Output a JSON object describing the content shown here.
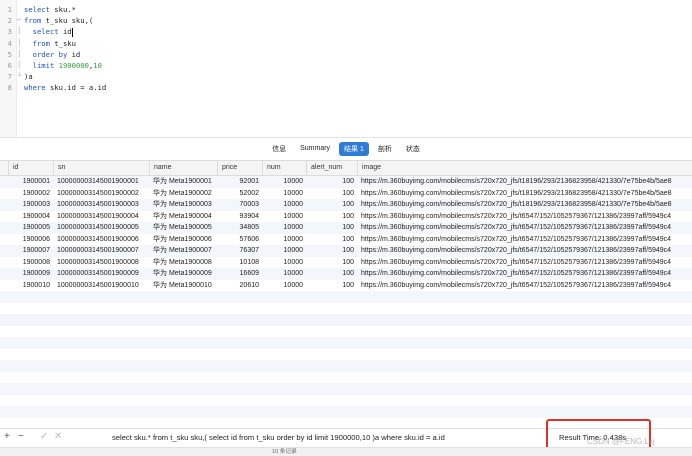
{
  "editor": {
    "lines": [
      {
        "num": "1",
        "fold": "",
        "segments": [
          {
            "t": "select",
            "c": "kw"
          },
          {
            "t": " sku.*",
            "c": "txt"
          }
        ]
      },
      {
        "num": "2",
        "fold": "⌐",
        "segments": [
          {
            "t": "from",
            "c": "kw"
          },
          {
            "t": " t_sku sku,(",
            "c": "txt"
          }
        ]
      },
      {
        "num": "3",
        "fold": "│",
        "segments": [
          {
            "t": "  select",
            "c": "kw"
          },
          {
            "t": " id",
            "c": "txt"
          },
          {
            "t": "|",
            "c": "cur"
          }
        ]
      },
      {
        "num": "4",
        "fold": "│",
        "segments": [
          {
            "t": "  from",
            "c": "kw"
          },
          {
            "t": " t_sku",
            "c": "txt"
          }
        ]
      },
      {
        "num": "5",
        "fold": "│",
        "segments": [
          {
            "t": "  order by",
            "c": "kw"
          },
          {
            "t": " id",
            "c": "txt"
          }
        ]
      },
      {
        "num": "6",
        "fold": "│",
        "segments": [
          {
            "t": "  limit",
            "c": "kw"
          },
          {
            "t": " ",
            "c": "txt"
          },
          {
            "t": "1900000",
            "c": "num"
          },
          {
            "t": ",",
            "c": "txt"
          },
          {
            "t": "10",
            "c": "num"
          }
        ]
      },
      {
        "num": "7",
        "fold": "└",
        "segments": [
          {
            "t": ")a",
            "c": "txt"
          }
        ]
      },
      {
        "num": "8",
        "fold": "",
        "segments": [
          {
            "t": "where",
            "c": "kw"
          },
          {
            "t": " sku.id = a.id",
            "c": "txt"
          }
        ]
      }
    ]
  },
  "tabs": [
    {
      "label": "信息",
      "active": false
    },
    {
      "label": "Summary",
      "active": false
    },
    {
      "label": "结果 1",
      "active": true
    },
    {
      "label": "剖析",
      "active": false
    },
    {
      "label": "状态",
      "active": false
    }
  ],
  "table": {
    "columns": [
      "id",
      "sn",
      "name",
      "price",
      "num",
      "alert_num",
      "image"
    ],
    "rows": [
      [
        "1900001",
        "100000003145001900001",
        "华为 Meta1900001",
        "92001",
        "10000",
        "100",
        "https://m.360buyimg.com/mobilecms/s720x720_jfs/t18196/293/2136823958/421330/7e75be4b/5ae8"
      ],
      [
        "1900002",
        "100000003145001900002",
        "华为 Meta1900002",
        "52002",
        "10000",
        "100",
        "https://m.360buyimg.com/mobilecms/s720x720_jfs/t18196/293/2136823958/421330/7e75be4b/5ae8"
      ],
      [
        "1900003",
        "100000003145001900003",
        "华为 Meta1900003",
        "70003",
        "10000",
        "100",
        "https://m.360buyimg.com/mobilecms/s720x720_jfs/t18196/293/2136823958/421330/7e75be4b/5ae8"
      ],
      [
        "1900004",
        "100000003145001900004",
        "华为 Meta1900004",
        "93904",
        "10000",
        "100",
        "https://m.360buyimg.com/mobilecms/s720x720_jfs/t6547/152/1052579367/121386/23997aff/5949c4"
      ],
      [
        "1900005",
        "100000003145001900005",
        "华为 Meta1900005",
        "34805",
        "10000",
        "100",
        "https://m.360buyimg.com/mobilecms/s720x720_jfs/t6547/152/1052579367/121386/23997aff/5949c4"
      ],
      [
        "1900006",
        "100000003145001900006",
        "华为 Meta1900006",
        "57606",
        "10000",
        "100",
        "https://m.360buyimg.com/mobilecms/s720x720_jfs/t6547/152/1052579367/121386/23997aff/5949c4"
      ],
      [
        "1900007",
        "100000003145001900007",
        "华为 Meta1900007",
        "76307",
        "10000",
        "100",
        "https://m.360buyimg.com/mobilecms/s720x720_jfs/t6547/152/1052579367/121386/23997aff/5949c4"
      ],
      [
        "1900008",
        "100000003145001900008",
        "华为 Meta1900008",
        "10108",
        "10000",
        "100",
        "https://m.360buyimg.com/mobilecms/s720x720_jfs/t6547/152/1052579367/121386/23997aff/5949c4"
      ],
      [
        "1900009",
        "100000003145001900009",
        "华为 Meta1900009",
        "16609",
        "10000",
        "100",
        "https://m.360buyimg.com/mobilecms/s720x720_jfs/t6547/152/1052579367/121386/23997aff/5949c4"
      ],
      [
        "1900010",
        "100000003145001900010",
        "华为 Meta1900010",
        "20610",
        "10000",
        "100",
        "https://m.360buyimg.com/mobilecms/s720x720_jfs/t6547/152/1052579367/121386/23997aff/5949c4"
      ]
    ]
  },
  "bottom_bar": {
    "add_icon": "+",
    "remove_icon": "−",
    "apply_icon": "✓",
    "discard_icon": "✕",
    "query": "select sku.*  from t_sku sku,( select id from t_sku   order by id limit 1900000,10 )a where sku.id = a.id",
    "result_time": "Result Time: 0.438s"
  },
  "watermark": "CSDN @FENG.Lxj",
  "status_bar": {
    "record_count": "10 条记录"
  },
  "colors": {
    "accent": "#2f7bd8",
    "highlight_box": "#e0302a",
    "keyword": "#1c4fd6",
    "number": "#2f9d3a"
  }
}
